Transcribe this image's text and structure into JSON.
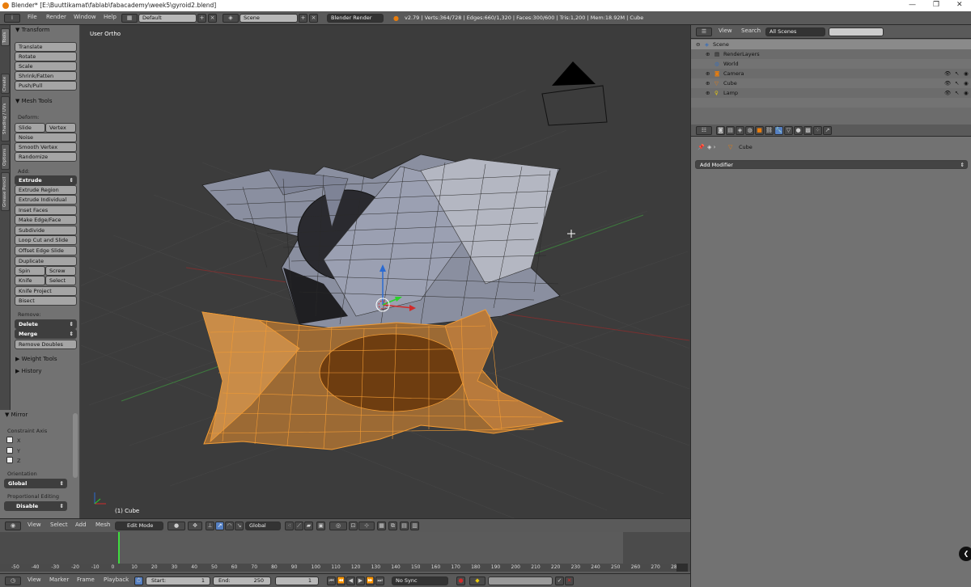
{
  "window": {
    "title": "Blender* [E:\\Buuttikamat\\fablab\\fabacademy\\week5\\gyroid2.blend]",
    "minimize": "—",
    "maximize": "❐",
    "close": "✕"
  },
  "topbar": {
    "menus": [
      "File",
      "Render",
      "Window",
      "Help"
    ],
    "layout": "Default",
    "scene": "Scene",
    "engine": "Blender Render",
    "stats": "v2.79 | Verts:364/728 | Edges:660/1,320 | Faces:300/600 | Tris:1,200 | Mem:18.92M | Cube"
  },
  "left_tabs": [
    "Tools",
    "Create",
    "Shading / UVs",
    "Options",
    "Grease Pencil"
  ],
  "tools": {
    "transform_header": "Transform",
    "transform": [
      "Translate",
      "Rotate",
      "Scale",
      "Shrink/Fatten",
      "Push/Pull"
    ],
    "mesh_tools_header": "Mesh Tools",
    "deform_label": "Deform:",
    "slide_edge": "Slide Edge",
    "vertex": "Vertex",
    "noise": "Noise",
    "smooth_vertex": "Smooth Vertex",
    "randomize": "Randomize",
    "add_label": "Add:",
    "extrude": "Extrude",
    "add_items": [
      "Extrude Region",
      "Extrude Individual",
      "Inset Faces",
      "Make Edge/Face",
      "Subdivide",
      "Loop Cut and Slide",
      "Offset Edge Slide",
      "Duplicate"
    ],
    "spin": "Spin",
    "screw": "Screw",
    "knife": "Knife",
    "select": "Select",
    "knife_project": "Knife Project",
    "bisect": "Bisect",
    "remove_label": "Remove:",
    "delete": "Delete",
    "merge": "Merge",
    "remove_doubles": "Remove Doubles",
    "weight_tools": "Weight Tools",
    "history": "History"
  },
  "mirror": {
    "header": "Mirror",
    "constraint_axis": "Constraint Axis",
    "axes": [
      "X",
      "Y",
      "Z"
    ],
    "orientation_label": "Orientation",
    "orientation": "Global",
    "proportional_label": "Proportional Editing",
    "proportional": "Disable"
  },
  "viewport": {
    "view_name": "User Ortho",
    "object_label": "(1) Cube",
    "colors": {
      "selected": "#f39c34",
      "grid_x": "#7a3030",
      "grid_y": "#3e7a3e",
      "mesh": "#8a8fa0"
    }
  },
  "view_header": {
    "menus": [
      "View",
      "Select",
      "Add",
      "Mesh"
    ],
    "mode": "Edit Mode",
    "orientation": "Global"
  },
  "timeline": {
    "ticks": [
      "-50",
      "-40",
      "-30",
      "-20",
      "-10",
      "0",
      "10",
      "20",
      "30",
      "40",
      "50",
      "60",
      "70",
      "80",
      "90",
      "100",
      "110",
      "120",
      "130",
      "140",
      "150",
      "160",
      "170",
      "180",
      "190",
      "200",
      "210",
      "220",
      "230",
      "240",
      "250",
      "260",
      "270",
      "280"
    ],
    "menus": [
      "View",
      "Marker",
      "Frame",
      "Playback"
    ],
    "start_label": "Start:",
    "start": "1",
    "end_label": "End:",
    "end": "250",
    "current": "1",
    "sync": "No Sync"
  },
  "outliner": {
    "menus": [
      "View",
      "Search"
    ],
    "filter": "All Scenes",
    "items": [
      "Scene",
      "RenderLayers",
      "World",
      "Camera",
      "Cube",
      "Lamp"
    ]
  },
  "properties": {
    "breadcrumb": "Cube",
    "add_modifier": "Add Modifier"
  }
}
